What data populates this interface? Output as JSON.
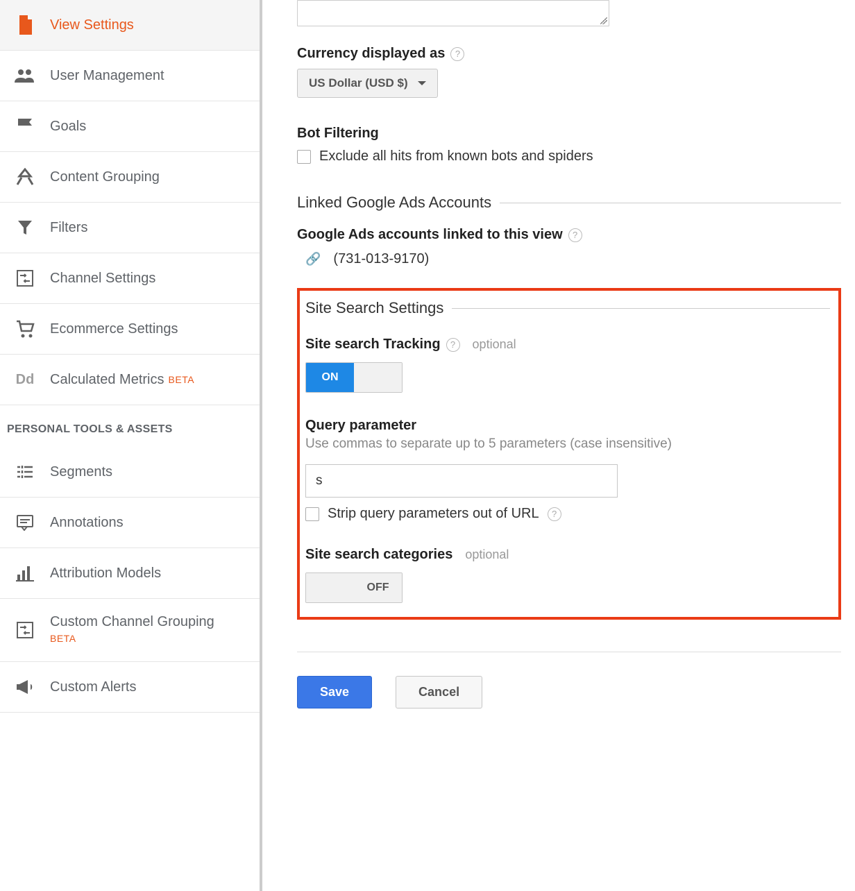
{
  "sidebar": {
    "items": [
      {
        "label": "View Settings"
      },
      {
        "label": "User Management"
      },
      {
        "label": "Goals"
      },
      {
        "label": "Content Grouping"
      },
      {
        "label": "Filters"
      },
      {
        "label": "Channel Settings"
      },
      {
        "label": "Ecommerce Settings"
      },
      {
        "label": "Calculated Metrics",
        "beta": "BETA"
      }
    ],
    "section_title": "PERSONAL TOOLS & ASSETS",
    "tools": [
      {
        "label": "Segments"
      },
      {
        "label": "Annotations"
      },
      {
        "label": "Attribution Models"
      },
      {
        "label": "Custom Channel Grouping",
        "beta": "BETA"
      },
      {
        "label": "Custom Alerts"
      }
    ]
  },
  "main": {
    "currency": {
      "label": "Currency displayed as",
      "value": "US Dollar (USD $)"
    },
    "bot_filtering": {
      "label": "Bot Filtering",
      "checkbox_label": "Exclude all hits from known bots and spiders"
    },
    "linked_ads": {
      "heading": "Linked Google Ads Accounts",
      "sub_label": "Google Ads accounts linked to this view",
      "account": "(731-013-9170)"
    },
    "site_search": {
      "heading": "Site Search Settings",
      "tracking_label": "Site search Tracking",
      "optional": "optional",
      "toggle_on": "ON",
      "toggle_off": "OFF",
      "query_label": "Query parameter",
      "query_desc": "Use commas to separate up to 5 parameters (case insensitive)",
      "query_value": "s",
      "strip_label": "Strip query parameters out of URL",
      "categories_label": "Site search categories"
    },
    "buttons": {
      "save": "Save",
      "cancel": "Cancel"
    }
  }
}
